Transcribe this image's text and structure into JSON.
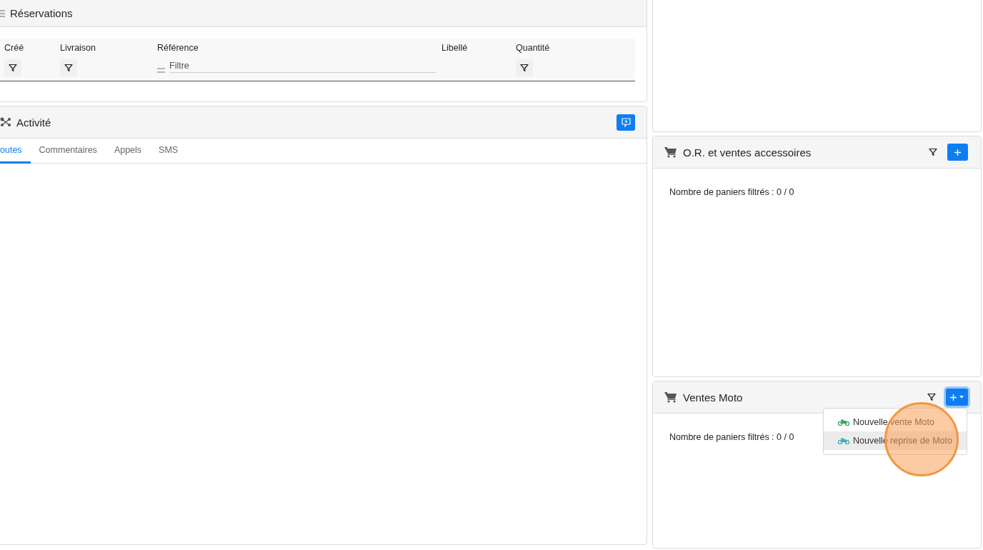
{
  "reservations": {
    "title": "Réservations",
    "columns": [
      {
        "label": "Créé",
        "kind": "button"
      },
      {
        "label": "Livraison",
        "kind": "button"
      },
      {
        "label": "Référence",
        "kind": "text",
        "placeholder": "Filtre"
      },
      {
        "label": "Libellé",
        "kind": "none"
      },
      {
        "label": "Quantité",
        "kind": "button"
      }
    ]
  },
  "activity": {
    "title": "Activité",
    "tabs": [
      {
        "label": "outes",
        "selected": true
      },
      {
        "label": "Commentaires",
        "selected": false
      },
      {
        "label": "Appels",
        "selected": false
      },
      {
        "label": "SMS",
        "selected": false
      }
    ]
  },
  "carts": [
    {
      "title": "O.R. et ventes accessoires",
      "summary": "Nombre de paniers filtrés : 0 / 0",
      "expanded": false
    },
    {
      "title": "Ventes Moto",
      "summary": "Nombre de paniers filtrés : 0 / 0",
      "expanded": true,
      "menu": [
        {
          "label": "Nouvelle vente Moto",
          "color": "#3aa65a",
          "selected": false
        },
        {
          "label": "Nouvelle reprise de Moto",
          "color": "#3aaec0",
          "selected": true
        }
      ]
    }
  ]
}
